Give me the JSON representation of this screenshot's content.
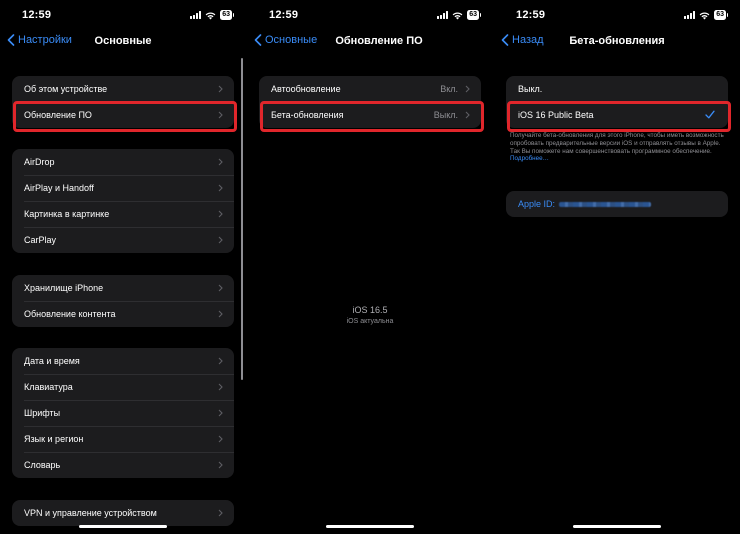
{
  "colors": {
    "accent": "#3a8cf7",
    "highlight": "#e0262b",
    "cell": "#1c1c1e",
    "secondary": "#8e8e93"
  },
  "screens": [
    {
      "time": "12:59",
      "battery": "63",
      "back_label": "Настройки",
      "title": "Основные",
      "groups": [
        [
          "Об этом устройстве",
          "Обновление ПО"
        ],
        [
          "AirDrop",
          "AirPlay и Handoff",
          "Картинка в картинке",
          "CarPlay"
        ],
        [
          "Хранилище iPhone",
          "Обновление контента"
        ],
        [
          "Дата и время",
          "Клавиатура",
          "Шрифты",
          "Язык и регион",
          "Словарь"
        ],
        [
          "VPN и управление устройством"
        ]
      ]
    },
    {
      "time": "12:59",
      "battery": "63",
      "back_label": "Основные",
      "title": "Обновление ПО",
      "rows": [
        {
          "label": "Автообновление",
          "value": "Вкл."
        },
        {
          "label": "Бета-обновления",
          "value": "Выкл."
        }
      ],
      "version": "iOS 16.5",
      "status": "iOS актуальна"
    },
    {
      "time": "12:59",
      "battery": "63",
      "back_label": "Назад",
      "title": "Бета-обновления",
      "options": [
        "Выкл.",
        "iOS 16 Public Beta"
      ],
      "selected": "iOS 16 Public Beta",
      "footnote": "Получайте бета-обновления для этого iPhone, чтобы иметь возможность опробовать предварительные версии iOS и отправлять отзывы в Apple. Так Вы поможете нам совершенствовать программное обеспечение.",
      "more_link": "Подробнее…",
      "apple_id_label": "Apple ID:"
    }
  ]
}
